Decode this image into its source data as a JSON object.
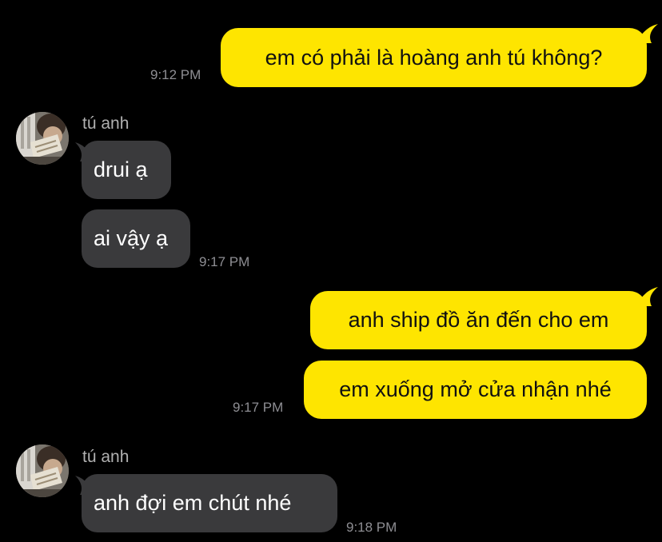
{
  "colors": {
    "background": "#000000",
    "outgoing_bubble": "#FEE500",
    "incoming_bubble": "#3A3A3C",
    "timestamp": "#8E8E93",
    "sender_name": "#B0B0B0"
  },
  "messages": [
    {
      "direction": "outgoing",
      "text": "em có phải là hoàng anh tú không?",
      "time": "9:12 PM"
    },
    {
      "direction": "incoming",
      "sender": "tú anh",
      "text": "drui ạ"
    },
    {
      "direction": "incoming",
      "text": "ai vậy ạ",
      "time": "9:17 PM"
    },
    {
      "direction": "outgoing",
      "text": "anh ship đồ ăn đến cho em"
    },
    {
      "direction": "outgoing",
      "text": "em xuống mở cửa nhận nhé",
      "time": "9:17 PM"
    },
    {
      "direction": "incoming",
      "sender": "tú anh",
      "text": "anh đợi em chút nhé",
      "time": "9:18 PM"
    }
  ]
}
